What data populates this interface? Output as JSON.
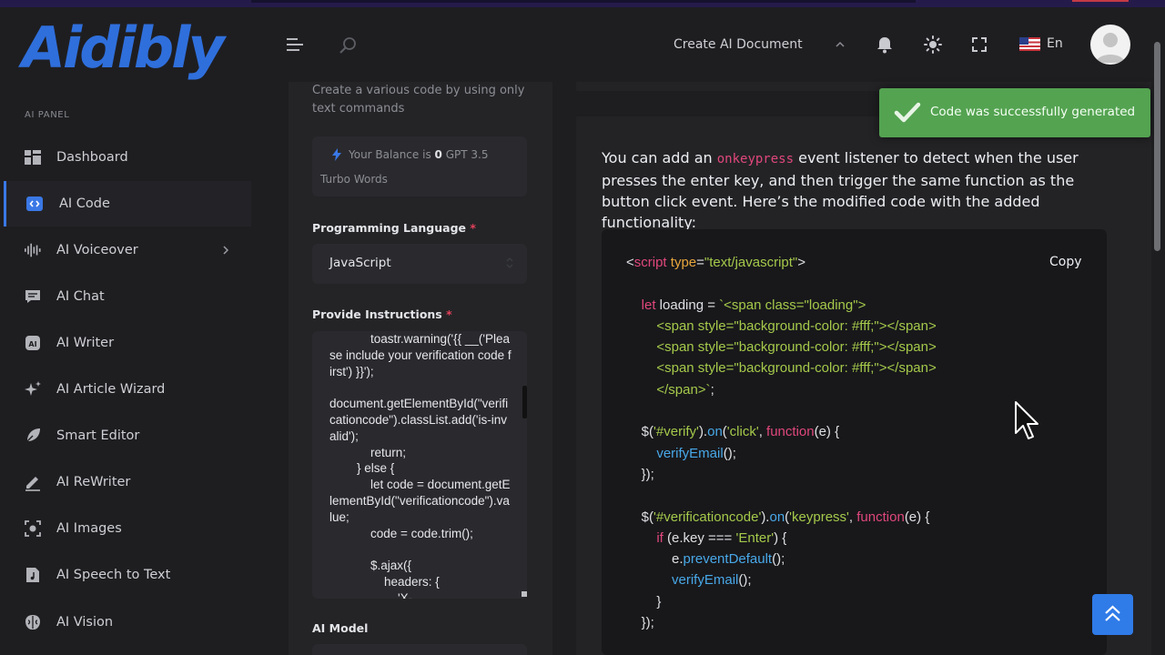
{
  "header": {
    "logo_text": "Aidibly",
    "create_doc": "Create AI Document",
    "language": "En"
  },
  "sidebar": {
    "section_title": "AI PANEL",
    "items": [
      {
        "label": "Dashboard",
        "icon": "dashboard-icon"
      },
      {
        "label": "AI Code",
        "icon": "code-icon",
        "active": true
      },
      {
        "label": "AI Voiceover",
        "icon": "waveform-icon",
        "has_submenu": true
      },
      {
        "label": "AI Chat",
        "icon": "chat-icon"
      },
      {
        "label": "AI Writer",
        "icon": "writer-icon"
      },
      {
        "label": "AI Article Wizard",
        "icon": "sparkle-icon"
      },
      {
        "label": "Smart Editor",
        "icon": "feather-icon"
      },
      {
        "label": "AI ReWriter",
        "icon": "pencil-icon"
      },
      {
        "label": "AI Images",
        "icon": "image-icon"
      },
      {
        "label": "AI Speech to Text",
        "icon": "audio-file-icon"
      },
      {
        "label": "AI Vision",
        "icon": "brain-icon"
      }
    ]
  },
  "form": {
    "description": "Create a various code by using only text commands",
    "balance_prefix": "Your Balance is",
    "balance_value": "0",
    "balance_suffix": "GPT 3.5",
    "balance_line2": "Turbo Words",
    "language_label": "Programming Language",
    "language_value": "JavaScript",
    "instructions_label": "Provide Instructions",
    "required_mark": "*",
    "instructions_text": "            toastr.warning('{{ __('Please include your verification code first') }}');\n\ndocument.getElementById(\"verificationcode\").classList.add('is-invalid');\n            return;\n        } else {\n            let code = document.getElementById(\"verificationcode\").value;\n            code = code.trim();\n\n            $.ajax({\n                headers: {\n                    'X-",
    "model_label": "AI Model"
  },
  "result": {
    "intro_before": "You can add an ",
    "intro_keyword": "onkeypress",
    "intro_after": " event listener to detect when the user presses the enter key, and then trigger the same function as the button click event. Here’s the modified code with the added functionality:",
    "copy_label": "Copy"
  },
  "toast": {
    "message": "Code was successfully generated"
  },
  "colors": {
    "accent": "#3a78e6",
    "toast_bg": "#54a351",
    "code_tag": "#e0477a",
    "code_string": "#a5c94a",
    "code_function": "#48a8e8",
    "code_attr": "#e7a53c"
  }
}
